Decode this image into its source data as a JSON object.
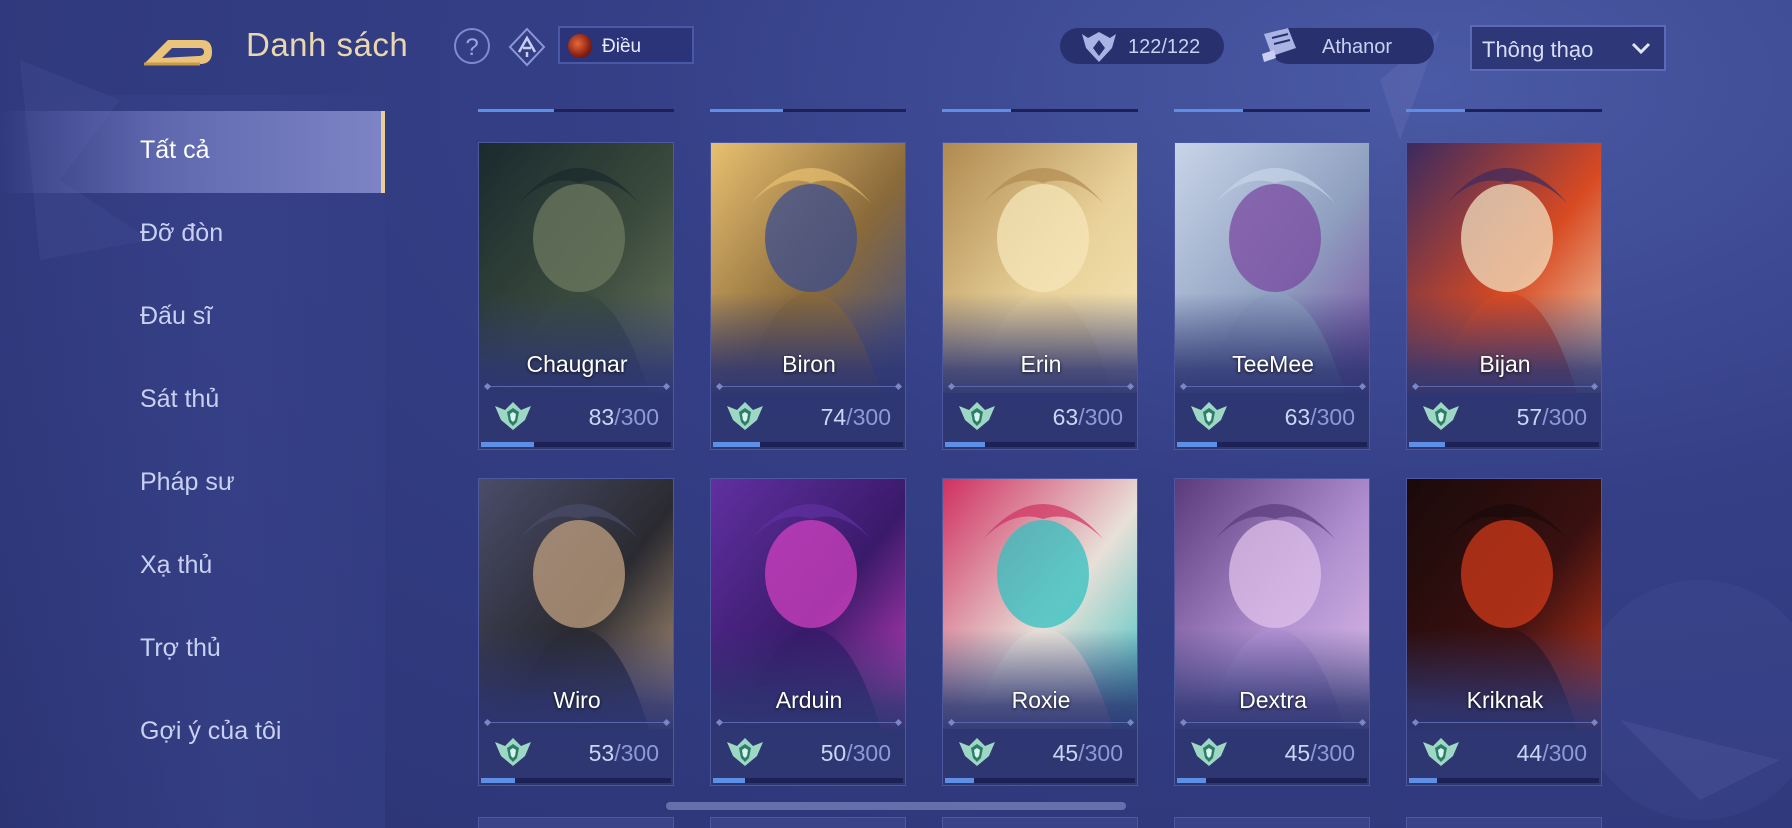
{
  "header": {
    "title": "Danh sách",
    "help_label": "?",
    "filter_label": "Điều",
    "hero_count": "122/122",
    "server_name": "Athanor",
    "sort": {
      "selected": "Thông thạo"
    }
  },
  "sidebar": {
    "items": [
      {
        "label": "Tất cả",
        "active": true
      },
      {
        "label": "Đỡ đòn"
      },
      {
        "label": "Đấu sĩ"
      },
      {
        "label": "Sát thủ"
      },
      {
        "label": "Pháp sư"
      },
      {
        "label": "Xạ thủ"
      },
      {
        "label": "Trợ thủ"
      },
      {
        "label": "Gợi ý của tôi"
      }
    ]
  },
  "heroes": [
    {
      "name": "Chaugnar",
      "points": "83",
      "max": "/300",
      "progress": 0.277,
      "art": "elephant-armor",
      "colors": [
        "#3a4a3c",
        "#6c7860",
        "#1a2a2e"
      ]
    },
    {
      "name": "Biron",
      "points": "74",
      "max": "/300",
      "progress": 0.247,
      "art": "blond-warrior",
      "colors": [
        "#8a6a3a",
        "#3b4d8f",
        "#e8c070"
      ]
    },
    {
      "name": "Erin",
      "points": "63",
      "max": "/300",
      "progress": 0.21,
      "art": "elf-girl",
      "colors": [
        "#e9d29a",
        "#f6e6b8",
        "#b08a50"
      ]
    },
    {
      "name": "TeeMee",
      "points": "63",
      "max": "/300",
      "progress": 0.21,
      "art": "raccoons",
      "colors": [
        "#8fa0c0",
        "#7a4aa0",
        "#c8d4e8"
      ]
    },
    {
      "name": "Bijan",
      "points": "57",
      "max": "/300",
      "progress": 0.19,
      "art": "red-hair-warrior",
      "colors": [
        "#d84a22",
        "#f0e0c0",
        "#3a2a60"
      ]
    },
    {
      "name": "Wiro",
      "points": "53",
      "max": "/300",
      "progress": 0.177,
      "art": "dark-hair-warrior",
      "colors": [
        "#2a2a30",
        "#c0a080",
        "#4a4c6a"
      ]
    },
    {
      "name": "Arduin",
      "points": "50",
      "max": "/300",
      "progress": 0.167,
      "art": "purple-armor",
      "colors": [
        "#3a1a6a",
        "#d040c0",
        "#6030a0"
      ]
    },
    {
      "name": "Roxie",
      "points": "45",
      "max": "/300",
      "progress": 0.15,
      "art": "teal-hair-girl",
      "colors": [
        "#e8e0d8",
        "#30c0c0",
        "#d03060"
      ]
    },
    {
      "name": "Dextra",
      "points": "45",
      "max": "/300",
      "progress": 0.15,
      "art": "lavender-hair-girl",
      "colors": [
        "#b090d0",
        "#e0c0e8",
        "#5a3a7a"
      ]
    },
    {
      "name": "Kriknak",
      "points": "44",
      "max": "/300",
      "progress": 0.147,
      "art": "red-mech",
      "colors": [
        "#3a1010",
        "#d03a1a",
        "#1a0a0a"
      ]
    }
  ],
  "top_strip_progress": [
    0.39,
    0.37,
    0.35,
    0.35,
    0.3
  ],
  "colors": {
    "accent": "#e8cf9a",
    "progress": "#5d8fe6",
    "panel": "#2f3773"
  },
  "icons": {
    "back": "back-arrow-icon",
    "help": "help-icon",
    "filter": "hero-filter-icon",
    "count": "hero-crest-icon",
    "server": "scroll-icon",
    "sort_chevron": "chevron-down-icon",
    "rank": "mastery-rank-icon"
  }
}
